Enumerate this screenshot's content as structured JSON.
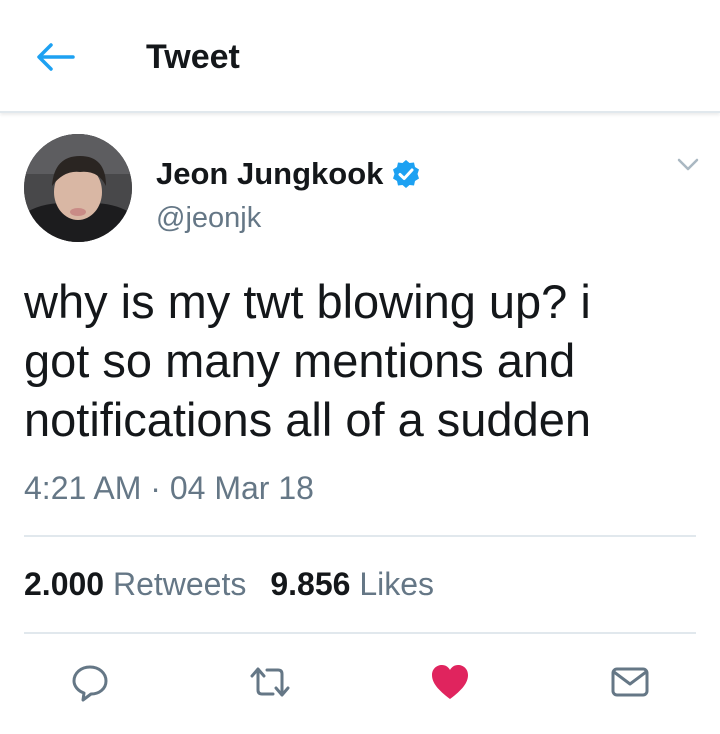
{
  "header": {
    "title": "Tweet",
    "back_icon": "arrow-left-icon"
  },
  "tweet": {
    "author": {
      "display_name": "Jeon Jungkook",
      "handle": "@jeonjk",
      "verified": true
    },
    "text": "why is my twt blowing up? i\ngot so many mentions and\nnotifications all of a sudden",
    "time": "4:21 AM",
    "separator": "·",
    "date": "04 Mar 18",
    "stats": {
      "retweets_count": "2.000",
      "retweets_label": "Retweets",
      "likes_count": "9.856",
      "likes_label": "Likes"
    },
    "actions": [
      {
        "name": "reply",
        "icon": "reply-icon"
      },
      {
        "name": "retweet",
        "icon": "retweet-icon"
      },
      {
        "name": "like",
        "icon": "heart-icon",
        "active": true
      },
      {
        "name": "share",
        "icon": "mail-icon"
      }
    ]
  },
  "colors": {
    "accent": "#1da1f2",
    "like_active": "#e0245e",
    "text_primary": "#14171a",
    "text_secondary": "#657786",
    "divider": "#e1e8ed"
  }
}
